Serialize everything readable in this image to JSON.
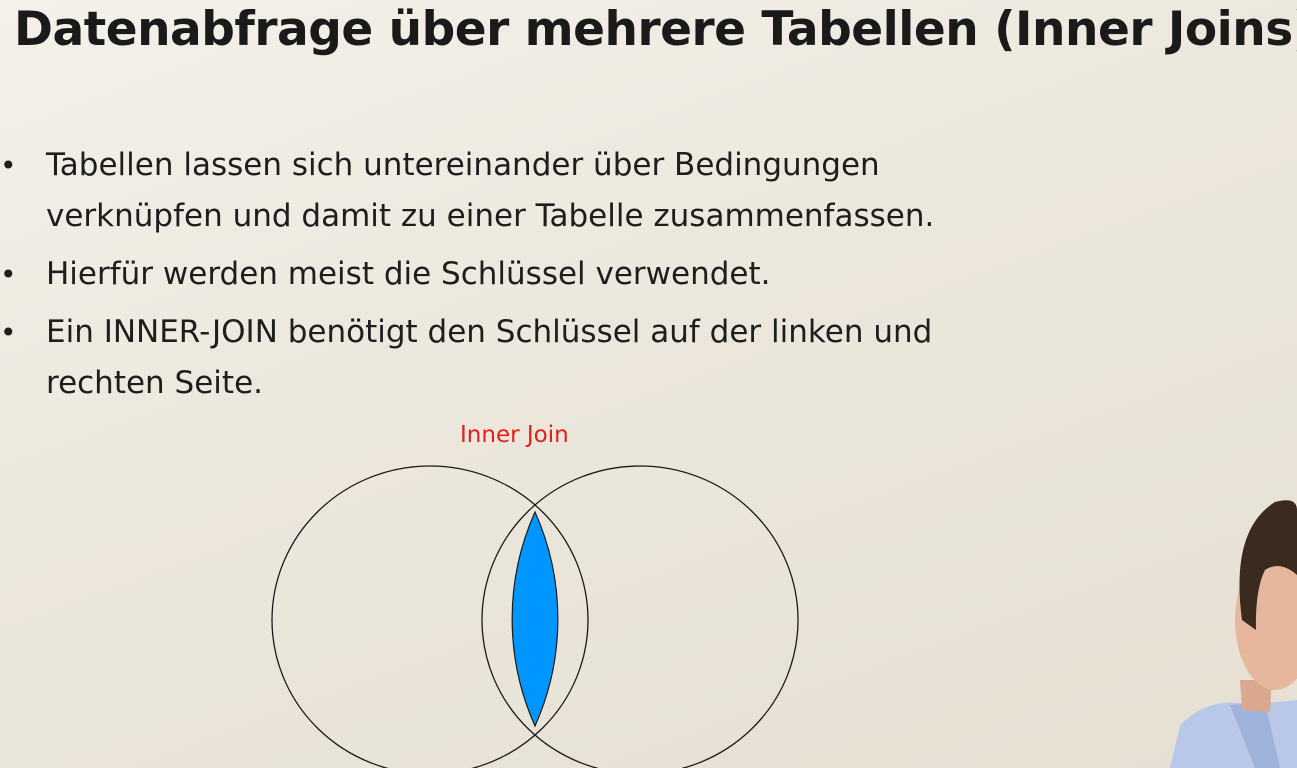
{
  "slide": {
    "title": "Datenabfrage über mehrere Tabellen (Inner Joins)",
    "bullets": [
      "Tabellen lassen sich untereinander über Bedingungen verknüpfen und damit zu einer Tabelle zusammenfassen.",
      "Hierfür werden meist die Schlüssel verwendet.",
      "Ein INNER-JOIN benötigt den Schlüssel auf der linken und rechten Seite."
    ]
  },
  "diagram": {
    "label": "Inner Join",
    "label_color": "#e0201c",
    "intersection_color": "#0096ff",
    "outline_color": "#1a1a1a"
  }
}
